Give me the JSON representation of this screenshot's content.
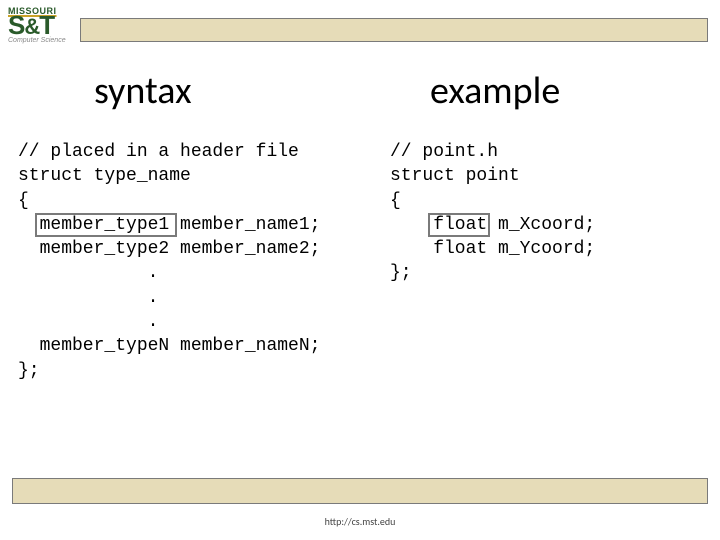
{
  "logo": {
    "line1": "MISSOURI",
    "line2": "S&T",
    "sub": "Computer Science"
  },
  "headings": {
    "left": "syntax",
    "right": "example"
  },
  "code": {
    "left": "// placed in a header file\nstruct type_name\n{\n  member_type1 member_name1;\n  member_type2 member_name2;\n            .\n            .\n            .\n  member_typeN member_nameN;\n};",
    "right": "// point.h\nstruct point\n{\n    float m_Xcoord;\n    float m_Ycoord;\n};"
  },
  "footer": "http://cs.mst.edu"
}
